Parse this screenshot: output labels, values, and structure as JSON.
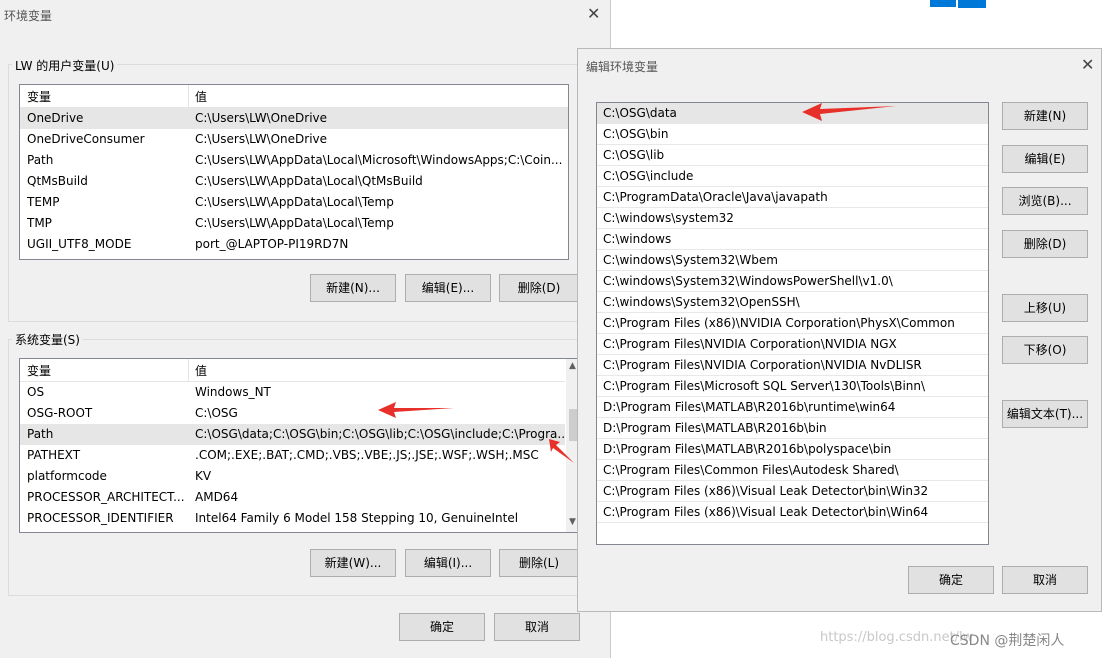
{
  "env_window": {
    "title": "环境变量",
    "user_group_label": "LW 的用户变量(U)",
    "user_columns": [
      "变量",
      "值"
    ],
    "user_rows": [
      {
        "name": "OneDrive",
        "value": "C:\\Users\\LW\\OneDrive"
      },
      {
        "name": "OneDriveConsumer",
        "value": "C:\\Users\\LW\\OneDrive"
      },
      {
        "name": "Path",
        "value": "C:\\Users\\LW\\AppData\\Local\\Microsoft\\WindowsApps;C:\\Coin..."
      },
      {
        "name": "QtMsBuild",
        "value": "C:\\Users\\LW\\AppData\\Local\\QtMsBuild"
      },
      {
        "name": "TEMP",
        "value": "C:\\Users\\LW\\AppData\\Local\\Temp"
      },
      {
        "name": "TMP",
        "value": "C:\\Users\\LW\\AppData\\Local\\Temp"
      },
      {
        "name": "UGII_UTF8_MODE",
        "value": "port_@LAPTOP-PI19RD7N"
      }
    ],
    "user_buttons": {
      "new": "新建(N)...",
      "edit": "编辑(E)...",
      "delete": "删除(D)"
    },
    "system_group_label": "系统变量(S)",
    "system_columns": [
      "变量",
      "值"
    ],
    "system_rows": [
      {
        "name": "OS",
        "value": "Windows_NT"
      },
      {
        "name": "OSG-ROOT",
        "value": "C:\\OSG"
      },
      {
        "name": "Path",
        "value": "C:\\OSG\\data;C:\\OSG\\bin;C:\\OSG\\lib;C:\\OSG\\include;C:\\Progra..."
      },
      {
        "name": "PATHEXT",
        "value": ".COM;.EXE;.BAT;.CMD;.VBS;.VBE;.JS;.JSE;.WSF;.WSH;.MSC"
      },
      {
        "name": "platformcode",
        "value": "KV"
      },
      {
        "name": "PROCESSOR_ARCHITECT...",
        "value": "AMD64"
      },
      {
        "name": "PROCESSOR_IDENTIFIER",
        "value": "Intel64 Family 6 Model 158 Stepping 10, GenuineIntel"
      }
    ],
    "system_buttons": {
      "new": "新建(W)...",
      "edit": "编辑(I)...",
      "delete": "删除(L)"
    },
    "ok": "确定",
    "cancel": "取消"
  },
  "edit_dialog": {
    "title": "编辑环境变量",
    "paths": [
      "C:\\OSG\\data",
      "C:\\OSG\\bin",
      "C:\\OSG\\lib",
      "C:\\OSG\\include",
      "C:\\ProgramData\\Oracle\\Java\\javapath",
      "C:\\windows\\system32",
      "C:\\windows",
      "C:\\windows\\System32\\Wbem",
      "C:\\windows\\System32\\WindowsPowerShell\\v1.0\\",
      "C:\\windows\\System32\\OpenSSH\\",
      "C:\\Program Files (x86)\\NVIDIA Corporation\\PhysX\\Common",
      "C:\\Program Files\\NVIDIA Corporation\\NVIDIA NGX",
      "C:\\Program Files\\NVIDIA Corporation\\NVIDIA NvDLISR",
      "C:\\Program Files\\Microsoft SQL Server\\130\\Tools\\Binn\\",
      "D:\\Program Files\\MATLAB\\R2016b\\runtime\\win64",
      "D:\\Program Files\\MATLAB\\R2016b\\bin",
      "D:\\Program Files\\MATLAB\\R2016b\\polyspace\\bin",
      "C:\\Program Files\\Common Files\\Autodesk Shared\\",
      "C:\\Program Files (x86)\\Visual Leak Detector\\bin\\Win32",
      "C:\\Program Files (x86)\\Visual Leak Detector\\bin\\Win64"
    ],
    "buttons": {
      "new": "新建(N)",
      "edit": "编辑(E)",
      "browse": "浏览(B)...",
      "delete": "删除(D)",
      "move_up": "上移(U)",
      "move_down": "下移(O)",
      "edit_text": "编辑文本(T)..."
    },
    "ok": "确定",
    "cancel": "取消"
  },
  "watermark": {
    "url": "https://blog.csdn.net/lw",
    "brand": "CSDN @荆楚闲人"
  },
  "accent_colors": {
    "arrow": "#e8302a",
    "windows_blue": "#0078d7"
  }
}
